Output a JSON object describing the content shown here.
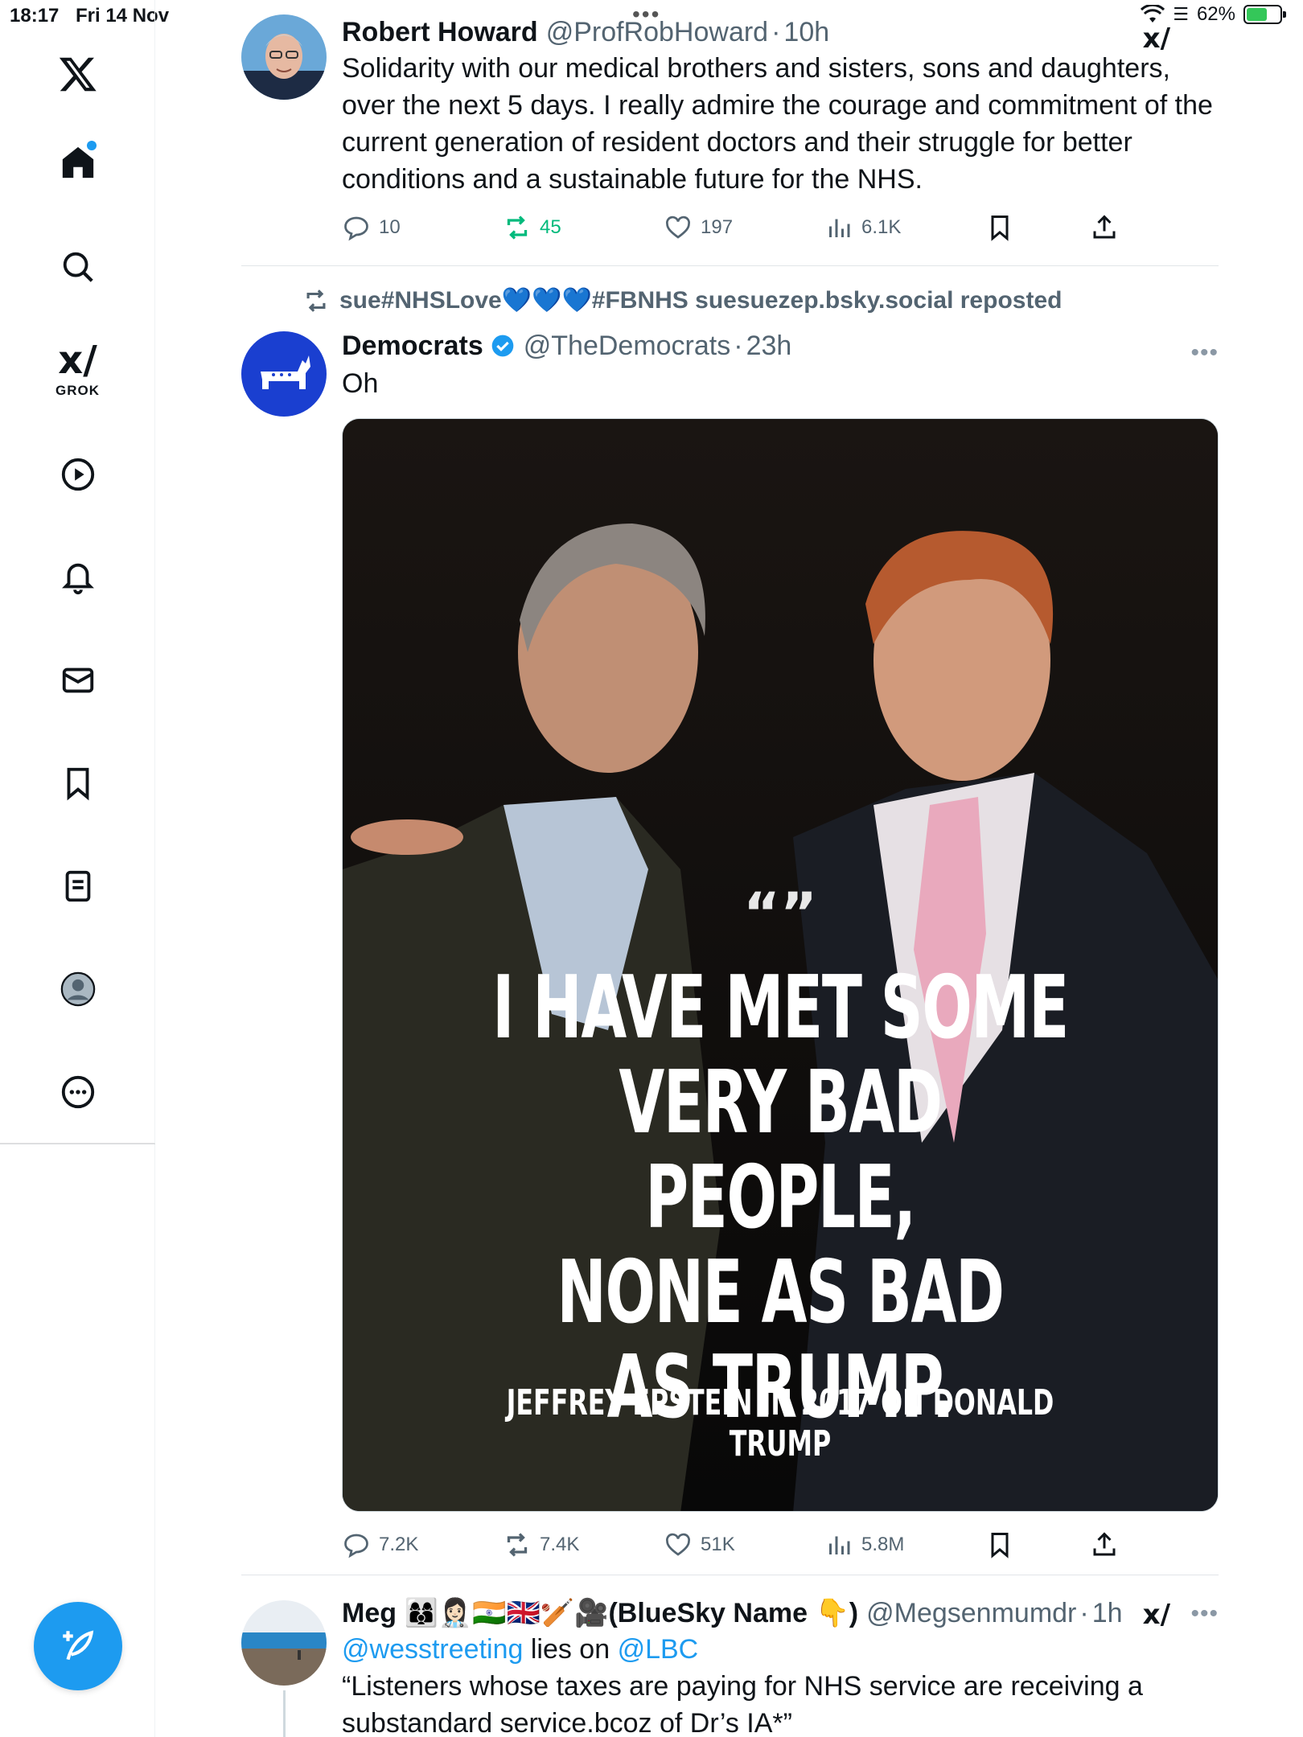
{
  "status": {
    "time": "18:17",
    "date": "Fri 14 Nov",
    "battery": "62%",
    "battery_level": 0.62
  },
  "sidebar": {
    "grok_label": "GROK",
    "items": [
      "home",
      "explore",
      "grok",
      "videos",
      "notifications",
      "messages",
      "bookmarks",
      "lists",
      "profile",
      "more"
    ]
  },
  "tweets": [
    {
      "name": "Robert Howard",
      "handle": "@ProfRobHoward",
      "time": "10h",
      "lines": [
        "Solidarity with our medical brothers and sisters, sons and daughters,",
        "over the next 5 days. I really admire the courage and commitment of the",
        "current generation of resident doctors and their struggle for better",
        "conditions and a  sustainable future for the NHS."
      ],
      "replies": "10",
      "reposts": "45",
      "likes": "197",
      "views": "6.1K"
    },
    {
      "reposted_by": "sue#NHSLove💙💙💙#FBNHS suesuezep.bsky.social reposted",
      "name": "Democrats",
      "handle": "@TheDemocrats",
      "time": "23h",
      "text": "Oh",
      "image": {
        "quote_mark": "“”",
        "quote_lines": [
          "I HAVE MET SOME",
          "VERY BAD PEOPLE,",
          "NONE AS BAD",
          "AS TRUMP."
        ],
        "attribution": "JEFFREY EPSTEIN IN 2017 ON DONALD TRUMP"
      },
      "replies": "7.2K",
      "reposts": "7.4K",
      "likes": "51K",
      "views": "5.8M"
    },
    {
      "name": "Meg 👩‍👩‍👦👩🏻‍⚕️🇮🇳🇬🇧🏏🎥(BlueSky Name 👇)",
      "handle": "@Megsenmumdr",
      "time": "1h",
      "mention1": "@wesstreeting",
      "mid": " lies on ",
      "mention2": "@LBC",
      "line2": "“Listeners whose taxes are paying for NHS service are receiving a",
      "line3": "substandard service.bcoz of Dr’s IA*”"
    }
  ],
  "colors": {
    "accent": "#1d9bf0",
    "repost_green": "#00ba7c",
    "muted": "#536471",
    "democrat_blue": "#1a3fd0"
  }
}
